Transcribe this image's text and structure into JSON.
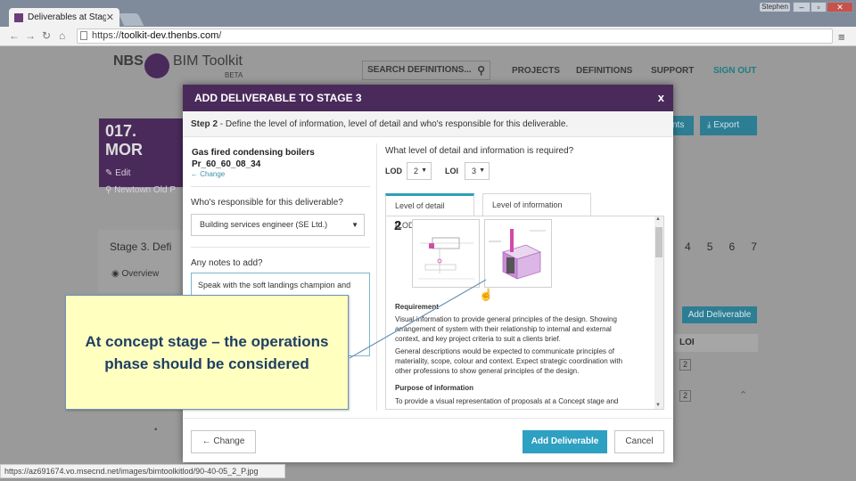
{
  "browser": {
    "tab_title": "Deliverables at Stage 3",
    "user_label": "Stephen",
    "url_protocol": "https://",
    "url_host": "toolkit-dev.thenbs.com",
    "url_path": "/",
    "status_url": "https://az691674.vo.msecnd.net/images/bimtoolkitlod/90-40-05_2_P.jpg"
  },
  "site": {
    "logo_prefix": "NBS",
    "logo_name": "BIM Toolkit",
    "logo_badge": "BETA",
    "search_placeholder": "SEARCH DEFINITIONS...",
    "nav": [
      "PROJECTS",
      "DEFINITIONS",
      "SUPPORT",
      "SIGN OUT"
    ]
  },
  "background": {
    "project_title": "017. MOR",
    "edit_label": "Edit",
    "location": "Newtown Old P",
    "stage_title": "Stage 3. Defi",
    "overview_label": "Overview",
    "stage_numbers": [
      "4",
      "5",
      "6",
      "7"
    ],
    "comments_btn": "nts",
    "export_btn": "Export",
    "add_deliverable_btn": "Add Deliverable",
    "table_loi": "LOI",
    "loi_values": [
      "2",
      "2"
    ],
    "side_text": "ing"
  },
  "modal": {
    "title": "ADD DELIVERABLE TO STAGE 3",
    "close": "x",
    "step_label": "Step 2",
    "step_text": " - Define the level of information, level of detail and who's responsible for this deliverable.",
    "product_name": "Gas fired condensing boilers",
    "product_code": "Pr_60_60_08_34",
    "change_link": "← Change",
    "responsible_question": "Who's responsible for this deliverable?",
    "responsible_value": "Building services engineer (SE Ltd.)",
    "notes_question": "Any notes to add?",
    "notes_value": "Speak with the soft landings champion and",
    "level_question": "What level of detail and information is required?",
    "lod_label": "LOD",
    "lod_value": "2",
    "loi_label": "LOI",
    "loi_value": "3",
    "tabs": [
      "Level of detail (LOD)",
      "Level of information (LOI)"
    ],
    "level_number": "2",
    "requirement_heading": "Requirement",
    "requirement_text1": "Visual information to provide general principles of the design. Showing arrangement of system with their relationship to internal and external context, and key project criteria to suit a clients brief.",
    "requirement_text2": "General descriptions would be expected to communicate principles of materiality, scope, colour and context. Expect strategic coordination with other professions to show general principles of the design.",
    "purpose_heading": "Purpose of information",
    "purpose_text": "To provide a visual representation of proposals at a Concept stage and",
    "back_button": "← Change",
    "add_button": "Add Deliverable",
    "cancel_button": "Cancel"
  },
  "callout": {
    "text": "At concept stage – the operations phase should be considered"
  }
}
